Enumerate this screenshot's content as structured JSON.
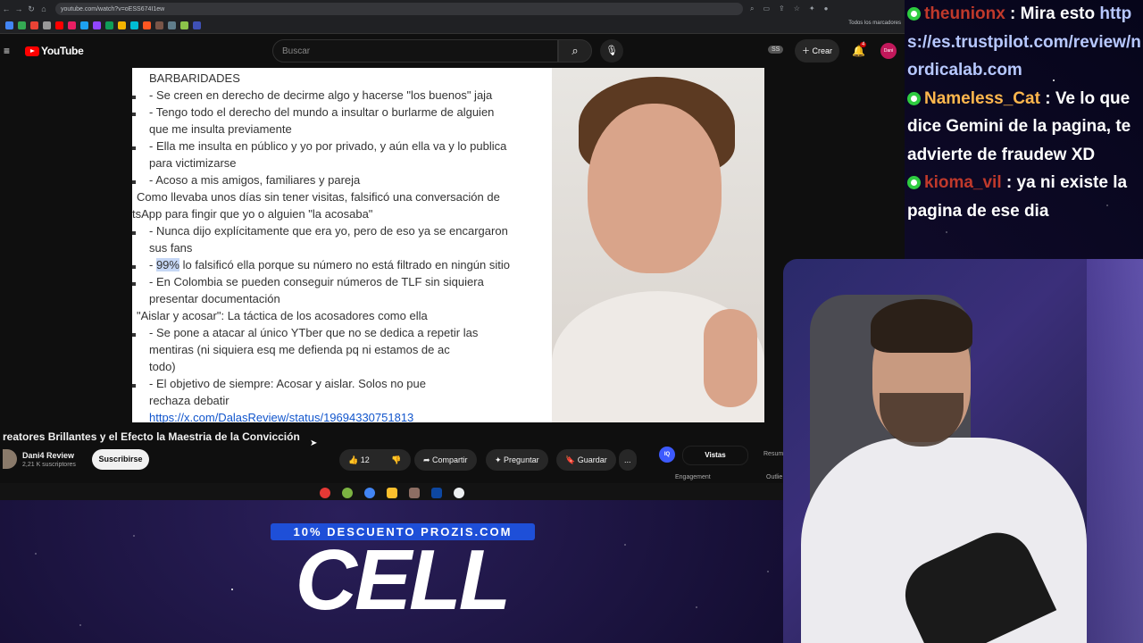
{
  "browser": {
    "url": "youtube.com/watch?v=oESS674I1ew",
    "bookmarks_all": "Todos los marcadores"
  },
  "youtube": {
    "logo_text": "YouTube",
    "search_placeholder": "Buscar",
    "ss_badge": "SS",
    "create_label": "Crear",
    "notif_count": "4",
    "avatar_text": "Dani"
  },
  "video_doc": {
    "lines": [
      {
        "text": "BARBARIDADES",
        "bullet": false
      },
      {
        "text": "- Se creen en derecho de decirme algo y hacerse \"los buenos\" jaja",
        "bullet": true
      },
      {
        "text": "- Tengo todo el derecho del mundo a insultar o burlarme de alguien",
        "bullet": true
      },
      {
        "text": "que me insulta previamente",
        "bullet": false
      },
      {
        "text": "- Ella me insulta en público y yo por privado, y aún ella va y lo publica",
        "bullet": true
      },
      {
        "text": "para victimizarse",
        "bullet": false
      },
      {
        "text": "- Acoso a mis amigos, familiares y pareja",
        "bullet": true
      },
      {
        "text": "Como llevaba unos días sin tener visitas, falsificó una conversación de",
        "bullet": false
      },
      {
        "text": "tsApp para fingir      que yo o alguien \"la acosaba\"",
        "bullet": false
      },
      {
        "text": "- Nunca dijo explícitamente que era yo, pero de eso ya se encargaron",
        "bullet": true
      },
      {
        "text": "sus fans",
        "bullet": false
      },
      {
        "text_hl": "99%",
        "text": " lo falsificó ella porque su número no está filtrado en ningún sitio",
        "bullet": true
      },
      {
        "text": "- En Colombia se pueden conseguir números de TLF sin siquiera",
        "bullet": true
      },
      {
        "text": "presentar documentación",
        "bullet": false
      },
      {
        "text": "\"Aislar y acosar\": La táctica de los acosadores como ella",
        "bullet": false
      },
      {
        "text": "- Se pone a atacar al único YTber que no se dedica a repetir las",
        "bullet": true
      },
      {
        "text": "mentiras (ni siquiera esq me defienda pq ni estamos de ac",
        "bullet": false
      },
      {
        "text": "todo)",
        "bullet": false
      },
      {
        "text": "- El objetivo de siempre: Acosar y aislar. Solos no pue",
        "bullet": true
      },
      {
        "text": "rechaza debatir",
        "bullet": false
      },
      {
        "text": "https://x.com/DalasReview/status/19694330751813",
        "bullet": false,
        "link": true
      }
    ]
  },
  "video_info": {
    "title": "reatores Brillantes y el Efecto la Maestria de la Convicción",
    "channel": "Dani4 Review",
    "subscribers": "2,21 K suscriptores",
    "subscribe_label": "Suscribirse",
    "likes": "12",
    "share_label": "Compartir",
    "ask_label": "Preguntar",
    "save_label": "Guardar",
    "more_label": "...",
    "iq_label": "IQ",
    "views_tab": "Vistas",
    "summary_tab": "Resum",
    "engagement_label": "Engagement",
    "outliers_label": "Outlie"
  },
  "chat": [
    {
      "user": "theunionx",
      "sep": " : ",
      "text": "Mira esto ",
      "url": "https://es.trustpilot.com/review/nordicalab.com"
    },
    {
      "user": "Nameless_Cat",
      "sep": " : ",
      "text": "Ve lo que dice Gemini de la pagina, te advierte de fraudew XD"
    },
    {
      "user": "kioma_vil",
      "sep": " : ",
      "text": "ya ni existe la pagina de ese dia"
    }
  ],
  "promo": {
    "banner": "10% DESCUENTO PROZIS.COM",
    "brand": "CELL"
  },
  "colors": {
    "yt_red": "#ff0000",
    "subscribe_bg": "#f1f1f1",
    "promo_blue": "#1e4fd8",
    "chat_badge": "#2ecc40"
  }
}
